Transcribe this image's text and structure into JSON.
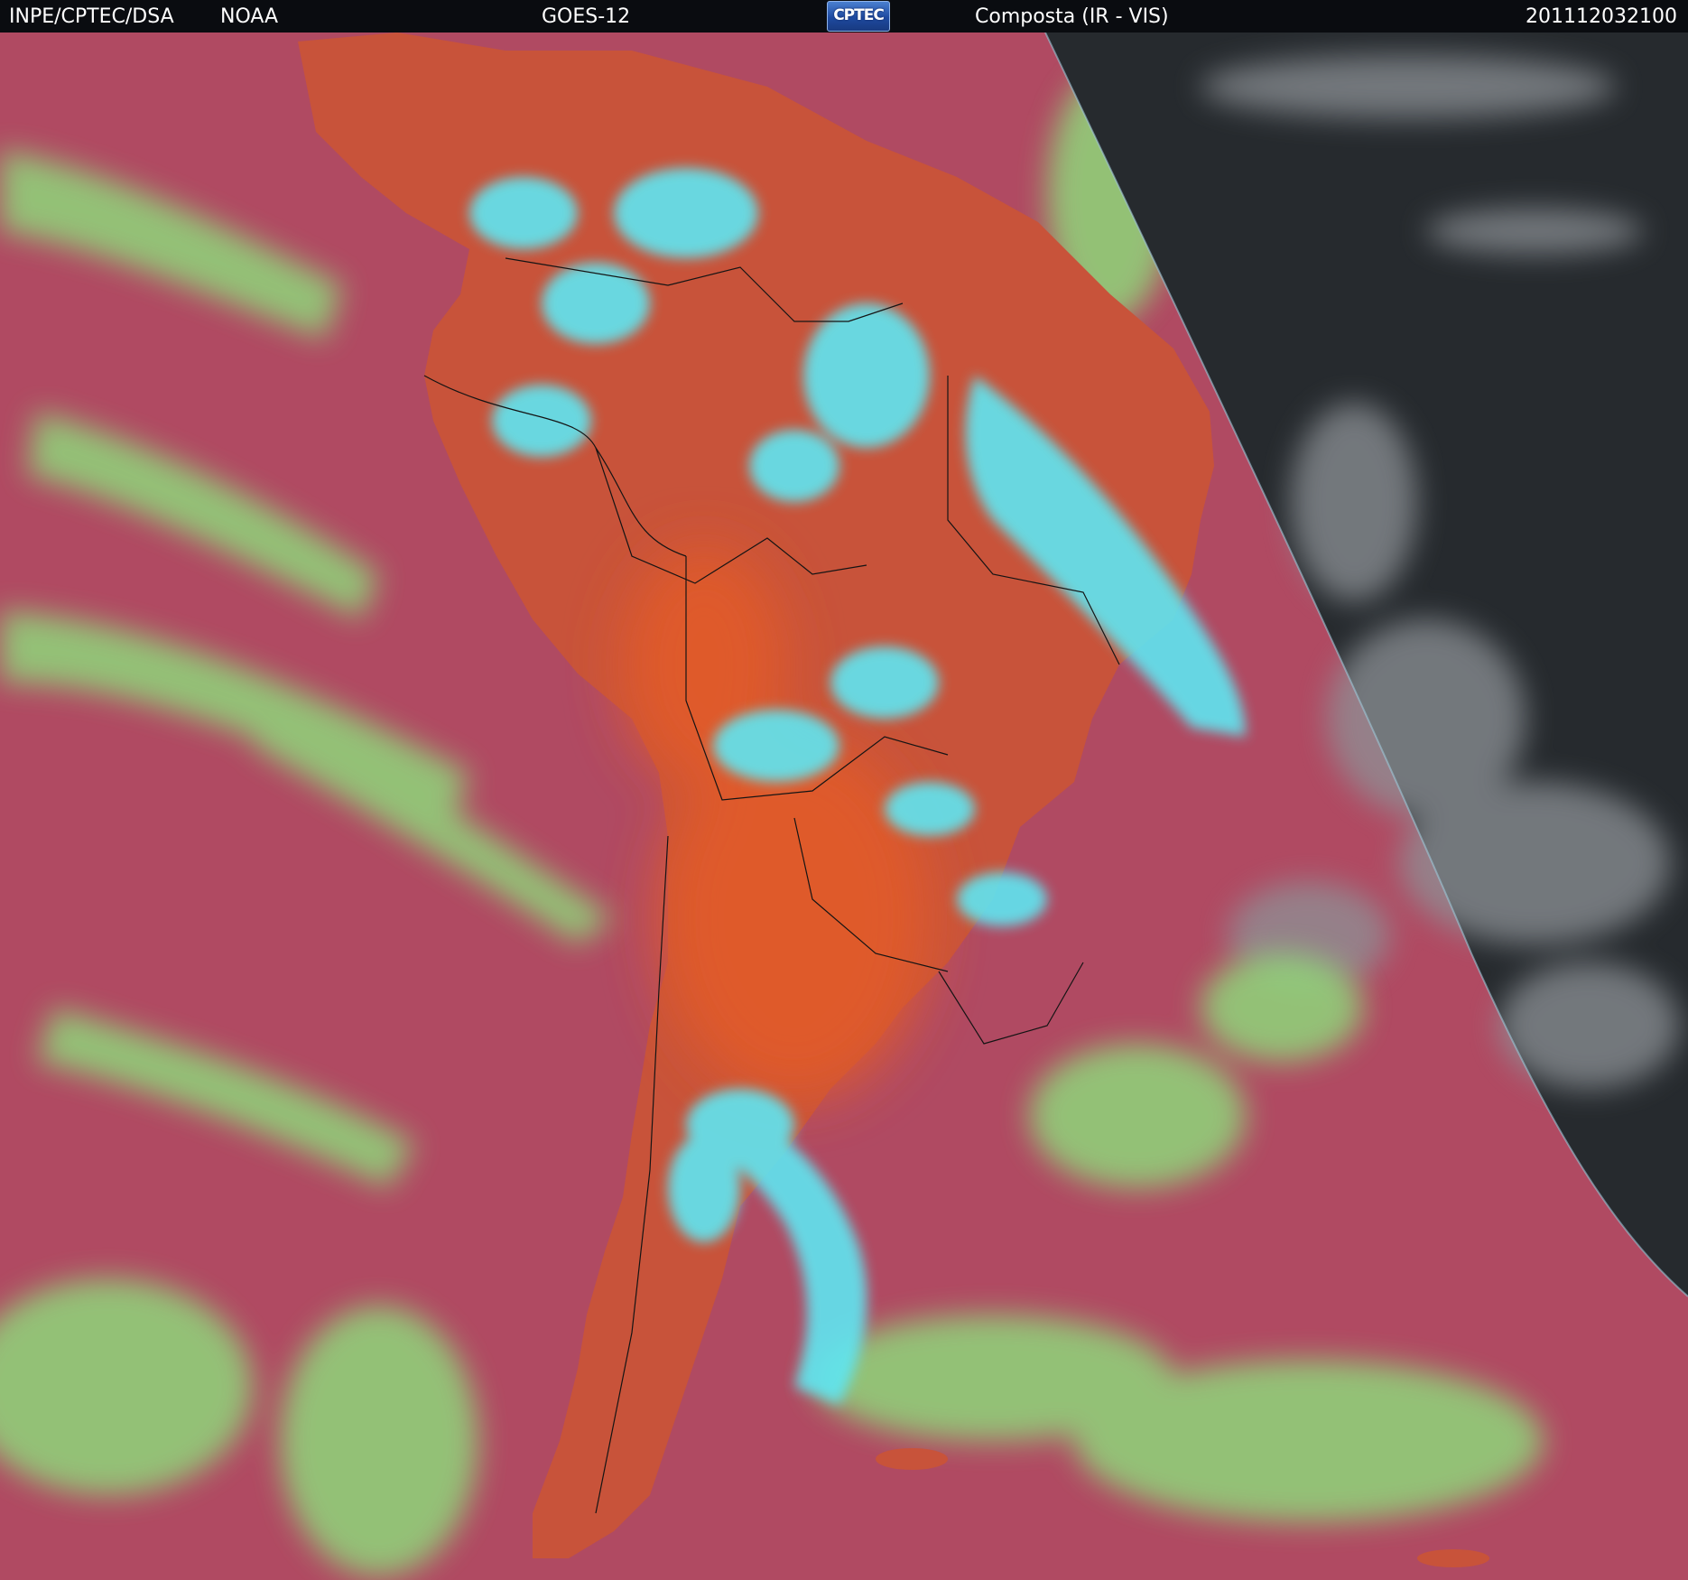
{
  "header": {
    "organization": "INPE/CPTEC/DSA",
    "agency": "NOAA",
    "satellite": "GOES-12",
    "logo_text": "CPTEC",
    "product": "Composta (IR - VIS)",
    "timestamp": "201112032100"
  },
  "colors": {
    "ocean": "#b04a62",
    "land": "#c8533a",
    "land_warm": "#df5a2a",
    "cloud_low": "#8fd67a",
    "cloud_high": "#5fe6f2",
    "night_side": "#262a2e",
    "night_cloud": "#8d9296",
    "border_line": "#141414"
  },
  "icons": {
    "logo": "cptec-logo"
  }
}
